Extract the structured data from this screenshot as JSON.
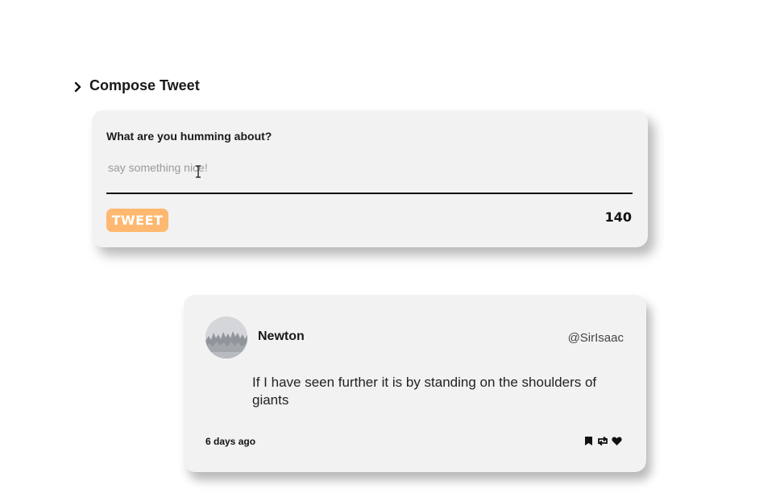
{
  "section": {
    "title": "Compose Tweet",
    "icon": "chevron-right-icon"
  },
  "compose": {
    "label": "What are you humming about?",
    "placeholder": "say something nice!",
    "value": "",
    "button_label": "TWEET",
    "char_count": "140",
    "accent_color": "#ffb870"
  },
  "tweet": {
    "author_name": "Newton",
    "author_handle": "@SirIsaac",
    "text": "If I have seen further it is by standing on the shoulders of giants",
    "timestamp": "6 days ago",
    "actions": [
      "flag-icon",
      "retweet-icon",
      "heart-icon"
    ]
  }
}
